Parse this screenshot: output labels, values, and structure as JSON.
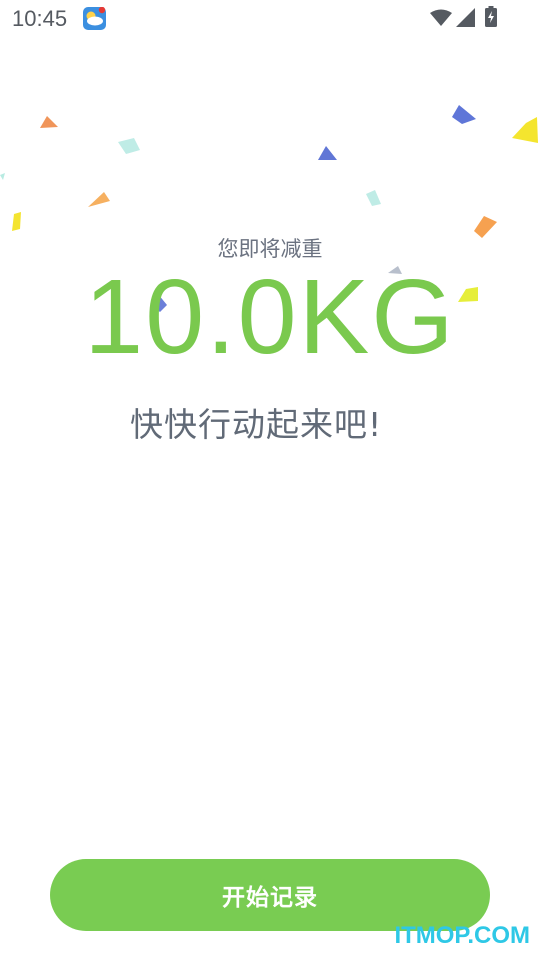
{
  "status_bar": {
    "time": "10:45"
  },
  "main": {
    "subtitle": "您即将减重",
    "value": "10.0KG",
    "motto": "快快行动起来吧!"
  },
  "actions": {
    "start_label": "开始记录"
  },
  "watermark": "ITMOP.COM",
  "colors": {
    "accent_green": "#79cc52",
    "value_green": "#7ac94e",
    "text_gray": "#616a77"
  }
}
